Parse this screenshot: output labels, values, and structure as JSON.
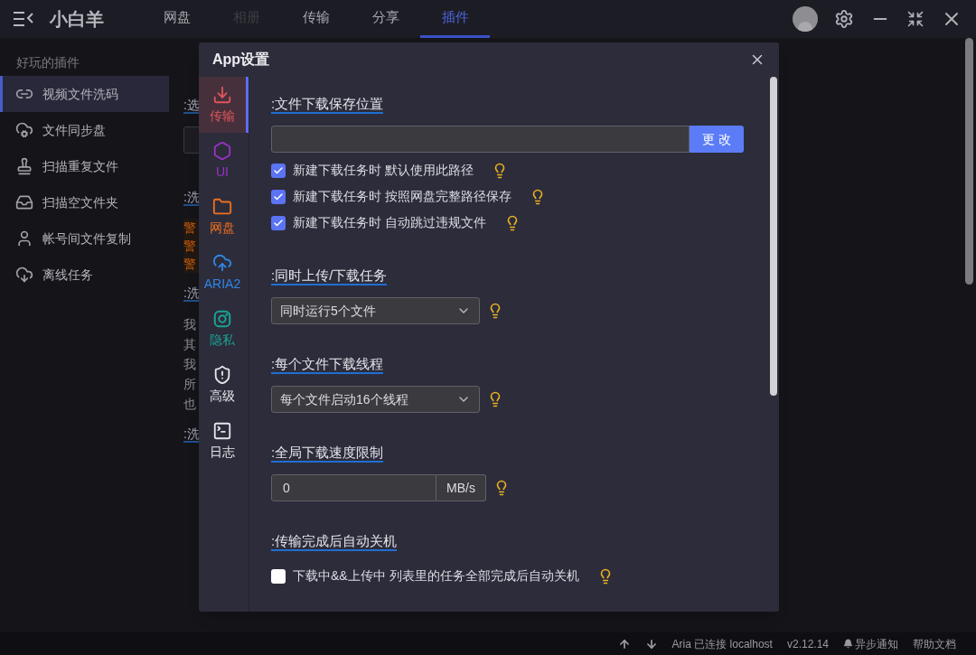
{
  "app": {
    "title": "小白羊",
    "tabs": [
      {
        "label": "网盘",
        "selected": false,
        "disabled": false
      },
      {
        "label": "相册",
        "selected": false,
        "disabled": true
      },
      {
        "label": "传输",
        "selected": false,
        "disabled": false
      },
      {
        "label": "分享",
        "selected": false,
        "disabled": false
      },
      {
        "label": "插件",
        "selected": true,
        "disabled": false
      }
    ]
  },
  "sidebar": {
    "heading": "好玩的插件",
    "items": [
      {
        "label": "视频文件洗码",
        "selected": true
      },
      {
        "label": "文件同步盘",
        "selected": false
      },
      {
        "label": "扫描重复文件",
        "selected": false
      },
      {
        "label": "扫描空文件夹",
        "selected": false
      },
      {
        "label": "帐号间文件复制",
        "selected": false
      },
      {
        "label": "离线任务",
        "selected": false
      }
    ]
  },
  "background": [
    {
      "kind": "heading",
      "text": ":选"
    },
    {
      "kind": "field"
    },
    {
      "kind": "heading",
      "text": ":洗"
    },
    {
      "kind": "warning",
      "text": "警"
    },
    {
      "kind": "warning",
      "text": "警"
    },
    {
      "kind": "warning",
      "text": "警"
    },
    {
      "kind": "heading",
      "text": ":洗"
    },
    {
      "kind": "text",
      "text": "我"
    },
    {
      "kind": "text",
      "text": "其"
    },
    {
      "kind": "text",
      "text": "我"
    },
    {
      "kind": "text",
      "text": "所"
    },
    {
      "kind": "text",
      "text": "也"
    },
    {
      "kind": "heading",
      "text": ":洗"
    }
  ],
  "modal": {
    "title": "App设置",
    "nav": [
      {
        "label": "传输",
        "selected": true,
        "color": "#e0565b"
      },
      {
        "label": "UI",
        "selected": false,
        "color": "#9b32c8"
      },
      {
        "label": "网盘",
        "selected": false,
        "color": "#f0701e"
      },
      {
        "label": "ARIA2",
        "selected": false,
        "color": "#2f86e6"
      },
      {
        "label": "隐私",
        "selected": false,
        "color": "#1aa393"
      },
      {
        "label": "高级",
        "selected": false,
        "color": "#e6e6ea"
      },
      {
        "label": "日志",
        "selected": false,
        "color": "#e6e6ea"
      }
    ],
    "sections": [
      {
        "kind": "path",
        "title": ":文件下载保存位置",
        "button": "更 改",
        "options": [
          {
            "label": "新建下载任务时 默认使用此路径",
            "checked": true
          },
          {
            "label": "新建下载任务时 按照网盘完整路径保存",
            "checked": true
          },
          {
            "label": "新建下载任务时 自动跳过违规文件",
            "checked": true
          }
        ]
      },
      {
        "kind": "select",
        "title": ":同时上传/下载任务",
        "value": "同时运行5个文件"
      },
      {
        "kind": "select",
        "title": ":每个文件下载线程",
        "value": "每个文件启动16个线程"
      },
      {
        "kind": "speed",
        "title": ":全局下载速度限制",
        "value": "0",
        "unit": "MB/s"
      },
      {
        "kind": "checks",
        "title": ":传输完成后自动关机",
        "options": [
          {
            "label": "下载中&&上传中 列表里的任务全部完成后自动关机",
            "checked": false
          }
        ]
      }
    ]
  },
  "status_bar": {
    "connection": "Aria 已连接 localhost",
    "version": "v2.12.14",
    "notify": "异步通知",
    "help": "帮助文档"
  }
}
